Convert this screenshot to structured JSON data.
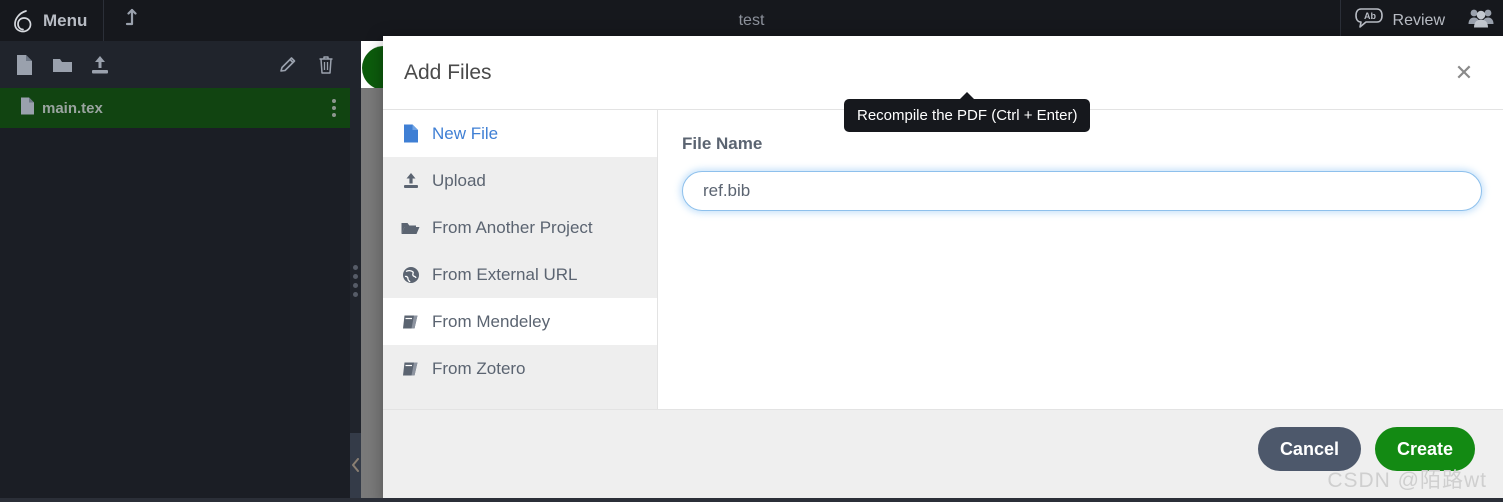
{
  "topbar": {
    "menu_label": "Menu",
    "logo_icon": "overleaf-logo-icon",
    "back_icon": "back-to-projects-icon",
    "project_title": "test",
    "review_label": "Review",
    "review_icon": "review-ab-bubble-icon",
    "people_icon": "collaborators-people-icon",
    "background": "#16181d"
  },
  "filetree": {
    "toolbar": {
      "new_file_icon": "new-file-icon",
      "new_folder_icon": "new-folder-icon",
      "upload_icon": "upload-icon",
      "rename_icon": "pencil-rename-icon",
      "delete_icon": "trash-delete-icon"
    },
    "files": [
      {
        "name": "main.tex",
        "icon": "tex-file-icon",
        "menu_icon": "vertical-dots-icon",
        "selected": true
      }
    ],
    "selected_background": "#114411"
  },
  "panel": {
    "resizer_icon": "drag-handle-dots-icon",
    "collapse_icon": "chevron-left-icon",
    "recompile_icon": "recompile-button"
  },
  "modal": {
    "title": "Add Files",
    "close_icon": "close-icon",
    "sources": [
      {
        "label": "New File",
        "icon": "file-icon",
        "active": true
      },
      {
        "label": "Upload",
        "icon": "upload-icon",
        "active": false
      },
      {
        "label": "From Another Project",
        "icon": "folder-open-icon",
        "active": false
      },
      {
        "label": "From External URL",
        "icon": "globe-icon",
        "active": false
      },
      {
        "label": "From Mendeley",
        "icon": "book-icon",
        "active": false
      },
      {
        "label": "From Zotero",
        "icon": "book-icon",
        "active": false
      }
    ],
    "form": {
      "label": "File Name",
      "value": "ref.bib",
      "placeholder": "File Name"
    },
    "footer": {
      "cancel_label": "Cancel",
      "create_label": "Create",
      "cancel_color": "#4d586b",
      "create_color": "#138a13"
    }
  },
  "tooltip": {
    "text": "Recompile the PDF (Ctrl + Enter)",
    "background": "#16181d"
  },
  "watermark": {
    "text": "CSDN @陌路wt"
  }
}
